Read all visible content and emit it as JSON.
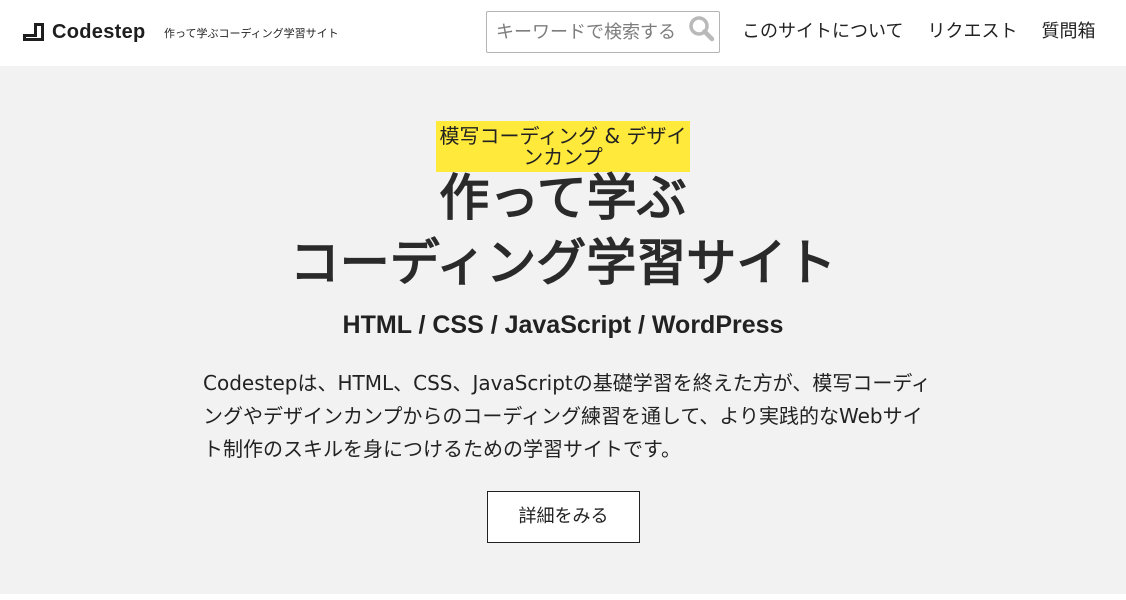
{
  "header": {
    "logo_text": "Codestep",
    "logo_icon": "stairs-step-icon",
    "tagline": "作って学ぶコーディング学習サイト",
    "search": {
      "placeholder": "キーワードで検索する",
      "value": "",
      "button_icon": "search-icon"
    },
    "nav": [
      {
        "label": "このサイトについて"
      },
      {
        "label": "リクエスト"
      },
      {
        "label": "質問箱"
      }
    ]
  },
  "hero": {
    "badge": "模写コーディング & デザインカンプ",
    "title_line1": "作って学ぶ",
    "title_line2": "コーディング学習サイト",
    "subtitle": "HTML / CSS / JavaScript / WordPress",
    "description": "Codestepは、HTML、CSS、JavaScriptの基礎学習を終えた方が、模写コーディングやデザインカンプからのコーディング練習を通して、より実践的なWebサイト制作のスキルを身につけるための学習サイトです。",
    "cta_label": "詳細をみる"
  },
  "colors": {
    "hero_background": "#f2f2f2",
    "badge_background": "#ffe93a",
    "text": "#222222",
    "header_background": "#ffffff"
  }
}
